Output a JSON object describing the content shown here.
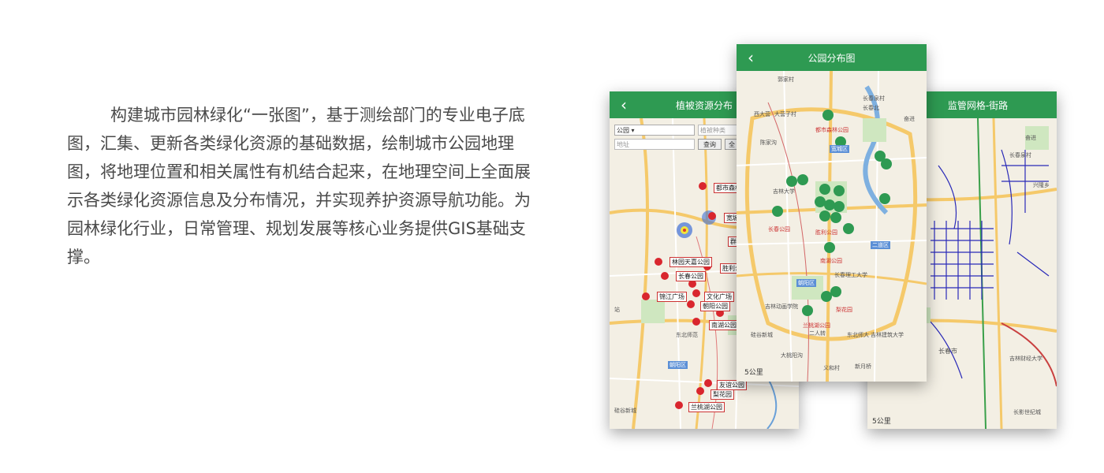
{
  "intro": {
    "paragraph": "构建城市园林绿化“一张图”，基于测绘部门的专业电子底图，汇集、更新各类绿化资源的基础数据，绘制城市公园地理图，将地理位置和相关属性有机结合起来，在地理空间上全面展示各类绿化资源信息及分布情况，并实现养护资源导航功能。为园林绿化行业，日常管理、规划发展等核心业务提供GIS基础支撑。"
  },
  "colors": {
    "header_green": "#2e9a52",
    "pin_red": "#d9262e",
    "park_green": "#2e9a52"
  },
  "phone_left": {
    "title": "植被资源分布",
    "back_icon": "chevron-left-icon",
    "select_value": "公园",
    "type_placeholder": "植被种类",
    "address_placeholder": "地址",
    "query_button": "查询",
    "clear_button": "全",
    "scale": "5公里",
    "labels": [
      "都市森林",
      "宽城",
      "群英",
      "林园天嘉公园",
      "胜利公",
      "长春公园",
      "锦江广场",
      "文化广场",
      "朝阳公园",
      "南湖公园",
      "友谊公园",
      "梨花园",
      "兰桃湖公园"
    ],
    "map_text": [
      "东北师范",
      "朝阳区",
      "硅谷新城",
      "站"
    ]
  },
  "phone_center": {
    "title": "公园分布图",
    "back_icon": "chevron-left-icon",
    "scale": "5公里",
    "map_text": [
      "郭家村",
      "西大营",
      "大营子村",
      "长春泉村",
      "长春北",
      "奋进",
      "都市森林公园",
      "宽城区",
      "陈家沟",
      "吉林大学",
      "长春公园",
      "胜利公园",
      "南湖公园",
      "长春理工大学",
      "朝阳区",
      "二道区",
      "吉林动画学院",
      "兰桃湖公园",
      "梨花园",
      "二人转",
      "东北师大",
      "大桃阳沟",
      "义和村",
      "吉林建筑大学",
      "新月桥",
      "硅谷新城"
    ]
  },
  "phone_right": {
    "title": "监管网格-街路",
    "back_icon": "chevron-left-icon",
    "scale": "5公里",
    "map_text": [
      "长春泉村",
      "奋进",
      "长春市",
      "吉林财经大学",
      "兴隆乡",
      "长影世纪城"
    ]
  }
}
